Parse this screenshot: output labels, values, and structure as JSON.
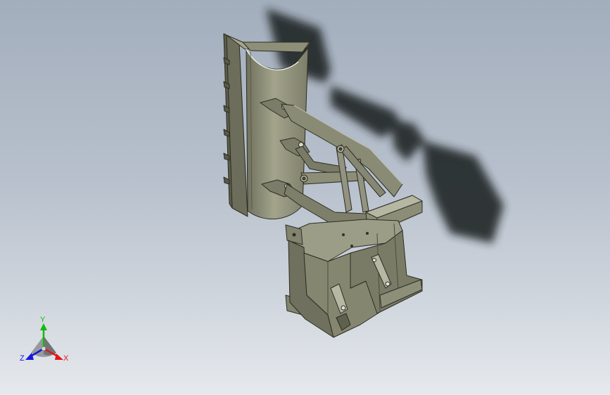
{
  "viewport": {
    "scene": "cad-3d-model",
    "background_colors": {
      "top": "#a3aebd",
      "bottom": "#e6e9ed"
    },
    "model_color": "#8f9078",
    "shadow_color": "#1e2022"
  },
  "triad": {
    "x_label": "X",
    "y_label": "Y",
    "z_label": "Z",
    "colors": {
      "x": "#e01818",
      "y": "#14b814",
      "z": "#1818d8"
    }
  }
}
